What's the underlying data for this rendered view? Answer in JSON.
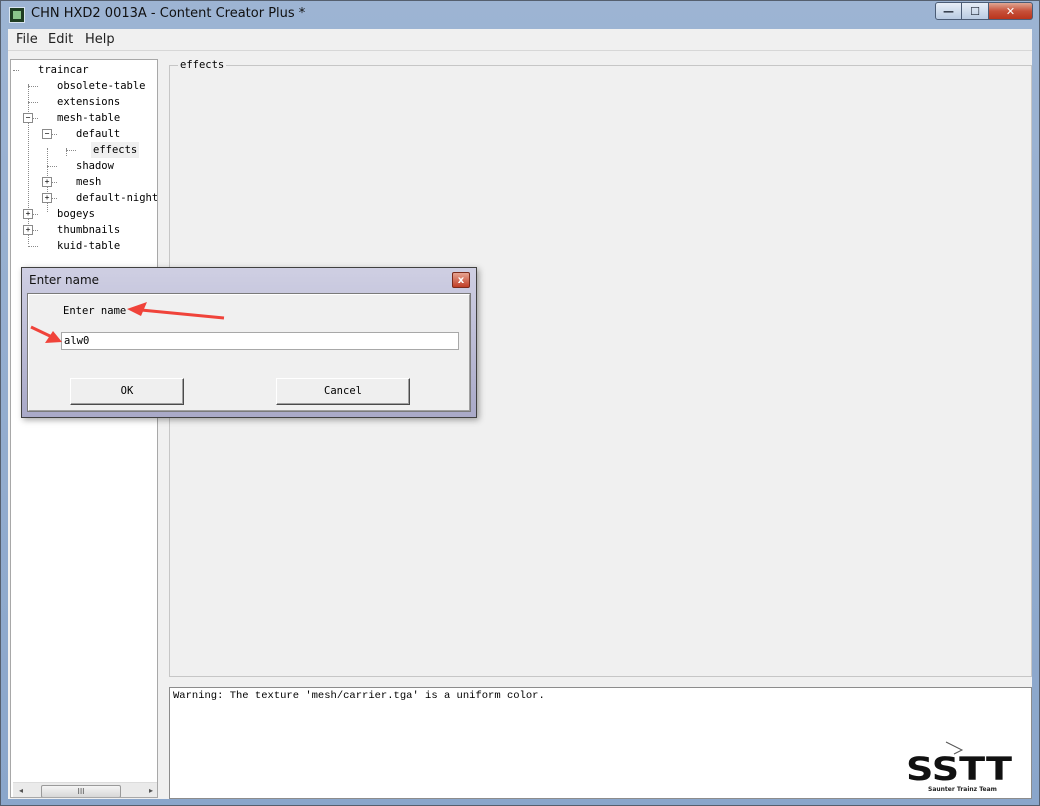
{
  "window": {
    "title": "CHN HXD2 0013A - Content Creator Plus *",
    "minimize_glyph": "—",
    "maximize_glyph": "☐",
    "close_glyph": "✕"
  },
  "menu": {
    "items": [
      "File",
      "Edit",
      "Help"
    ]
  },
  "tree": {
    "items": [
      {
        "label": "traincar",
        "depth": 0
      },
      {
        "label": "obsolete-table",
        "depth": 1
      },
      {
        "label": "extensions",
        "depth": 1
      },
      {
        "label": "mesh-table",
        "depth": 1,
        "expander": "−"
      },
      {
        "label": "default",
        "depth": 2,
        "expander": "−"
      },
      {
        "label": "effects",
        "depth": 3,
        "selected": true
      },
      {
        "label": "shadow",
        "depth": 2
      },
      {
        "label": "mesh",
        "depth": 2,
        "expander": "+"
      },
      {
        "label": "default-night-",
        "depth": 2,
        "expander": "+"
      },
      {
        "label": "bogeys",
        "depth": 1,
        "expander": "+"
      },
      {
        "label": "thumbnails",
        "depth": 1,
        "expander": "+"
      },
      {
        "label": "kuid-table",
        "depth": 1
      }
    ],
    "scroll_left": "◂",
    "scroll_right": "▸",
    "scroll_grip": "III"
  },
  "panel": {
    "title": "effects"
  },
  "log": {
    "text": "Warning: The texture 'mesh/carrier.tga' is a uniform color."
  },
  "dialog": {
    "title": "Enter name",
    "close_glyph": "x",
    "label": "Enter name",
    "input_value": "alw0",
    "ok_label": "OK",
    "cancel_label": "Cancel"
  },
  "watermark": {
    "logo_text": "SSTT",
    "caption": "Saunter Trainz Team"
  },
  "colors": {
    "annotation_arrow": "#f0433a",
    "dialog_title_grad": "#b3b3d0"
  }
}
